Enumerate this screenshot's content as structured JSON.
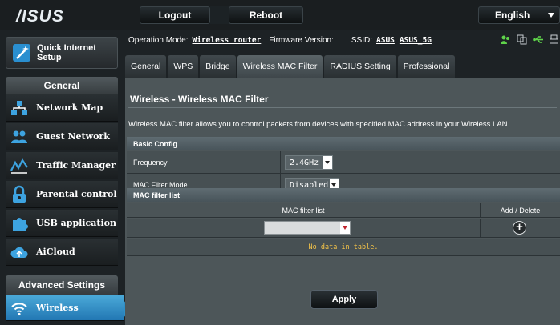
{
  "header": {
    "logo": "/ISUS",
    "logout_label": "Logout",
    "reboot_label": "Reboot",
    "language": "English"
  },
  "sidebar": {
    "qis_label": "Quick Internet Setup",
    "general_header": "General",
    "items": [
      {
        "label": "Network Map",
        "icon": "network-map-icon"
      },
      {
        "label": "Guest Network",
        "icon": "guest-network-icon"
      },
      {
        "label": "Traffic Manager",
        "icon": "traffic-manager-icon"
      },
      {
        "label": "Parental control",
        "icon": "lock-icon"
      },
      {
        "label": "USB application",
        "icon": "puzzle-icon"
      },
      {
        "label": "AiCloud",
        "icon": "cloud-icon"
      }
    ],
    "advanced_header": "Advanced Settings",
    "active_item": {
      "label": "Wireless",
      "icon": "wifi-icon"
    }
  },
  "status": {
    "opmode_label": "Operation Mode:",
    "opmode_value": "Wireless router",
    "firmware_label": "Firmware Version:",
    "ssid_label": "SSID:",
    "ssid1": "ASUS",
    "ssid2": "ASUS_5G"
  },
  "tabs": [
    "General",
    "WPS",
    "Bridge",
    "Wireless MAC Filter",
    "RADIUS Setting",
    "Professional"
  ],
  "active_tab": "Wireless MAC Filter",
  "panel": {
    "title": "Wireless - Wireless MAC Filter",
    "description": "Wireless MAC filter allows you to control packets from devices with specified MAC address in your Wireless LAN.",
    "basic_config_header": "Basic Config",
    "frequency_label": "Frequency",
    "frequency_value": "2.4GHz",
    "mac_filter_mode_label": "MAC Filter Mode",
    "mac_filter_mode_value": "Disabled",
    "mac_filter_list_header": "MAC filter list",
    "list_col1": "MAC filter list",
    "list_col2": "Add / Delete",
    "no_data": "No data in table.",
    "apply_label": "Apply"
  },
  "colors": {
    "accent": "#2f8fc7",
    "panel": "#4d5659",
    "nodata_text": "#f7c548",
    "status_icon_green": "#5fd34a"
  }
}
